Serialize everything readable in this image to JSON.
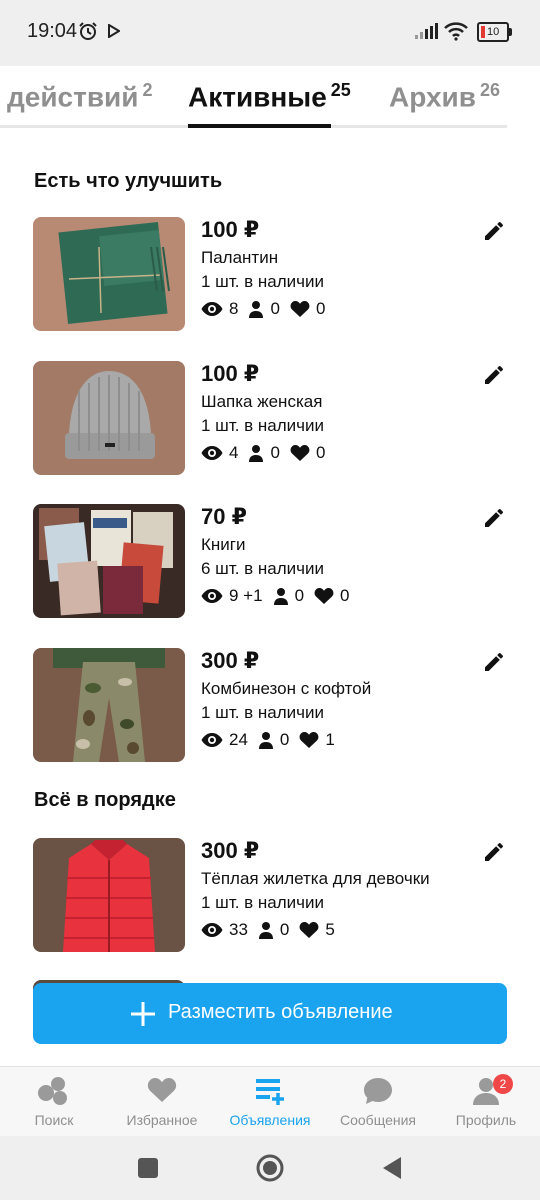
{
  "status_bar": {
    "time": "19:04",
    "battery": "10"
  },
  "tabs": [
    {
      "label": "действий",
      "count": "2"
    },
    {
      "label": "Активные",
      "count": "25"
    },
    {
      "label": "Архив",
      "count": "26"
    }
  ],
  "sections": {
    "improve_title": "Есть что улучшить",
    "ok_title": "Всё в порядке"
  },
  "listings": [
    {
      "price": "100 ₽",
      "name": "Палантин",
      "stock": "1 шт. в наличии",
      "views": "8",
      "contacts": "0",
      "favorites": "0"
    },
    {
      "price": "100 ₽",
      "name": "Шапка женская",
      "stock": "1 шт. в наличии",
      "views": "4",
      "contacts": "0",
      "favorites": "0"
    },
    {
      "price": "70 ₽",
      "name": "Книги",
      "stock": "6 шт. в наличии",
      "views": "9 +1",
      "contacts": "0",
      "favorites": "0"
    },
    {
      "price": "300 ₽",
      "name": "Комбинезон с кофтой",
      "stock": "1 шт. в наличии",
      "views": "24",
      "contacts": "0",
      "favorites": "1"
    },
    {
      "price": "300 ₽",
      "name": "Тёплая жилетка для девочки",
      "stock": "1 шт. в наличии",
      "views": "33",
      "contacts": "0",
      "favorites": "5"
    }
  ],
  "cta": {
    "label": "Разместить объявление"
  },
  "bottom_nav": [
    {
      "label": "Поиск",
      "icon": "search-bubbles-icon"
    },
    {
      "label": "Избранное",
      "icon": "heart-icon"
    },
    {
      "label": "Объявления",
      "icon": "listings-icon"
    },
    {
      "label": "Сообщения",
      "icon": "chat-icon"
    },
    {
      "label": "Профиль",
      "icon": "profile-icon",
      "badge": "2"
    }
  ],
  "colors": {
    "accent": "#1aa3ee",
    "badge": "#f04848",
    "inactive": "#8f8f8f"
  }
}
